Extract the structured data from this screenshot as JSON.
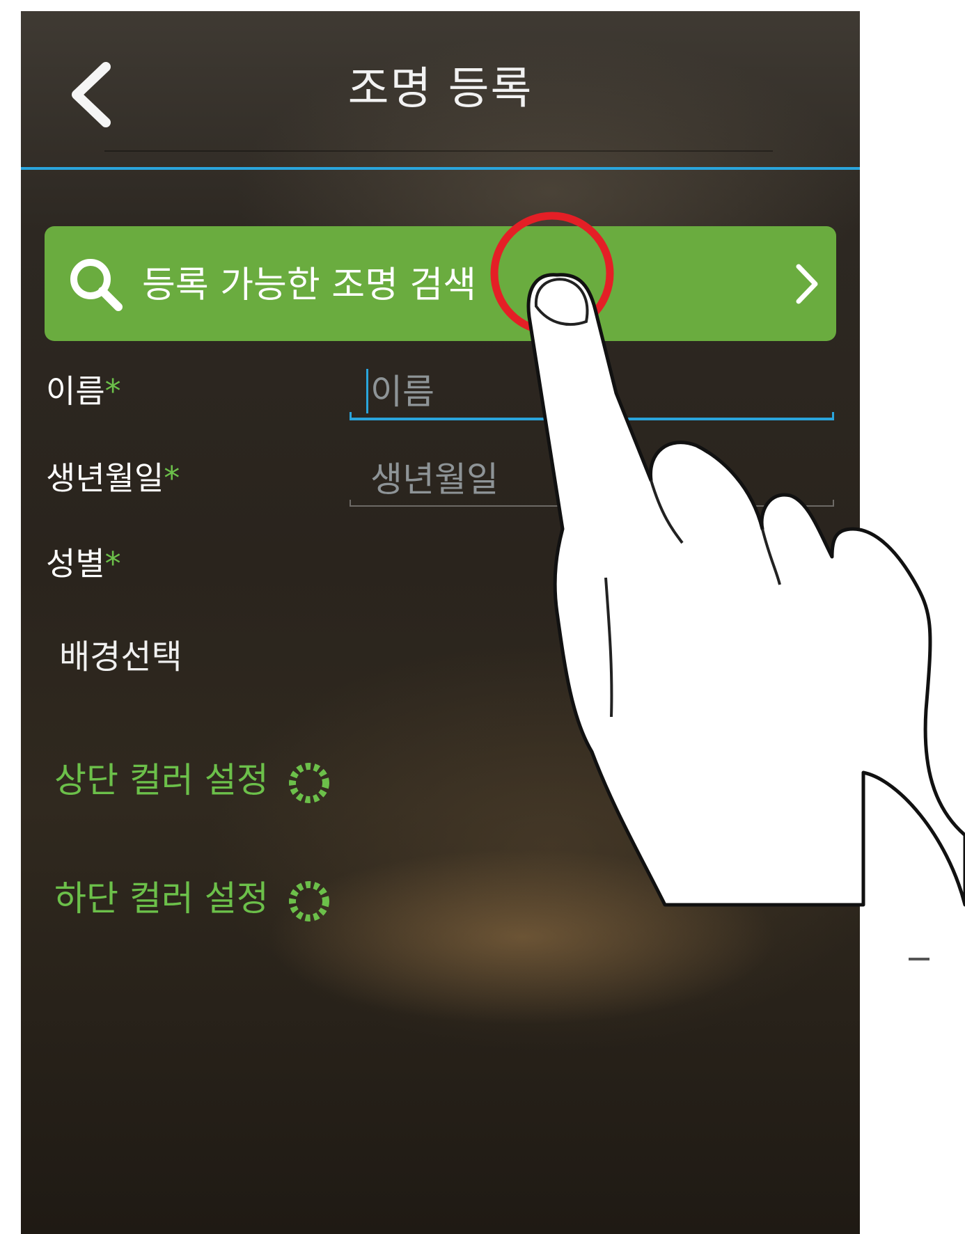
{
  "header": {
    "title": "조명 등록",
    "back_icon": "chevron-left-icon"
  },
  "search": {
    "label": "등록 가능한 조명 검색",
    "icon": "search-icon",
    "chevron": "chevron-right-icon",
    "color": "#6aac3f"
  },
  "form": {
    "name_label": "이름",
    "birth_label": "생년월일",
    "gender_label": "성별",
    "required_mark": "*",
    "name_placeholder": "이름",
    "birth_placeholder": "생년월일"
  },
  "background": {
    "label": "배경선택",
    "top_color_label": "상단 컬러 설정",
    "bottom_color_label": "하단 컬러 설정"
  },
  "colors": {
    "accent_blue": "#2aa5dc",
    "accent_green": "#6cc04a"
  }
}
